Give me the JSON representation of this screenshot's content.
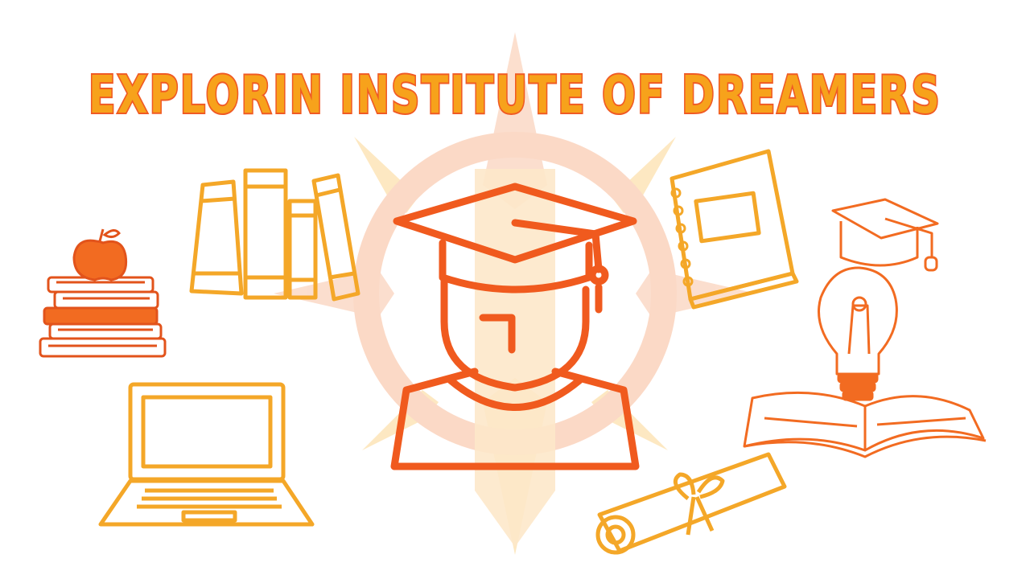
{
  "title": "EXPLORIN INSTITUTE OF DREAMERS",
  "colors": {
    "primary_orange": "#f26b21",
    "light_orange": "#f7a33a",
    "pale_orange": "#fbd9c6",
    "pale_yellow": "#fde5b8",
    "title_fill": "#f7a21b",
    "title_outline": "#f05a24"
  },
  "icons": [
    "compass-rose-icon",
    "graduate-avatar-icon",
    "apple-on-books-icon",
    "book-stack-icon",
    "notebook-icon",
    "laptop-icon",
    "diploma-scroll-icon",
    "graduation-cap-icon",
    "lightbulb-icon",
    "open-book-icon"
  ]
}
